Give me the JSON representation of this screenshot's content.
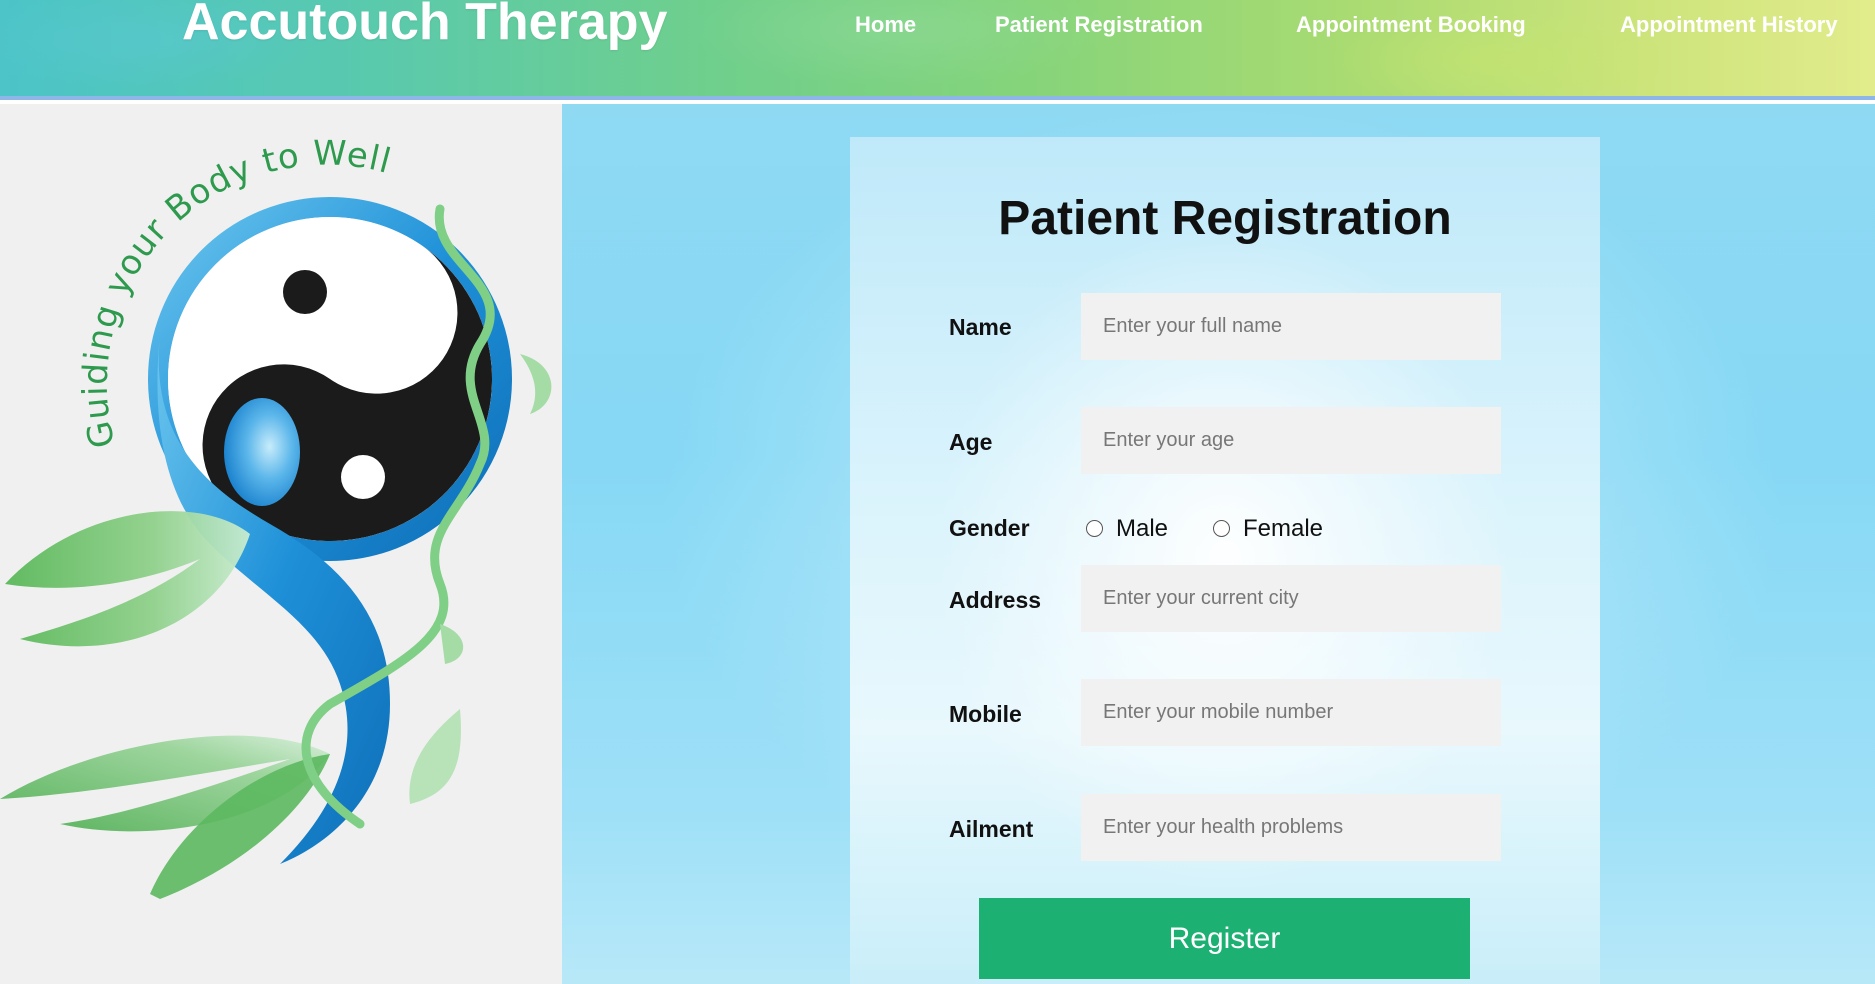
{
  "header": {
    "brand": "Accutouch Therapy",
    "nav": [
      "Home",
      "Patient Registration",
      "Appointment Booking",
      "Appointment History"
    ]
  },
  "logo": {
    "tagline": "Guiding your Body to Wellness."
  },
  "form": {
    "title": "Patient Registration",
    "name": {
      "label": "Name",
      "placeholder": "Enter your full name",
      "value": ""
    },
    "age": {
      "label": "Age",
      "placeholder": "Enter your age",
      "value": ""
    },
    "gender": {
      "label": "Gender",
      "options": [
        "Male",
        "Female"
      ],
      "selected": ""
    },
    "address": {
      "label": "Address",
      "placeholder": "Enter your current city",
      "value": ""
    },
    "mobile": {
      "label": "Mobile",
      "placeholder": "Enter your mobile number",
      "value": ""
    },
    "ailment": {
      "label": "Ailment",
      "placeholder": "Enter your health problems",
      "value": ""
    },
    "submit_label": "Register"
  },
  "colors": {
    "button": "#1cb073",
    "input_bg": "#f1f1f1",
    "logo_blue": "#1f8fd6",
    "logo_green": "#3fa55a"
  }
}
